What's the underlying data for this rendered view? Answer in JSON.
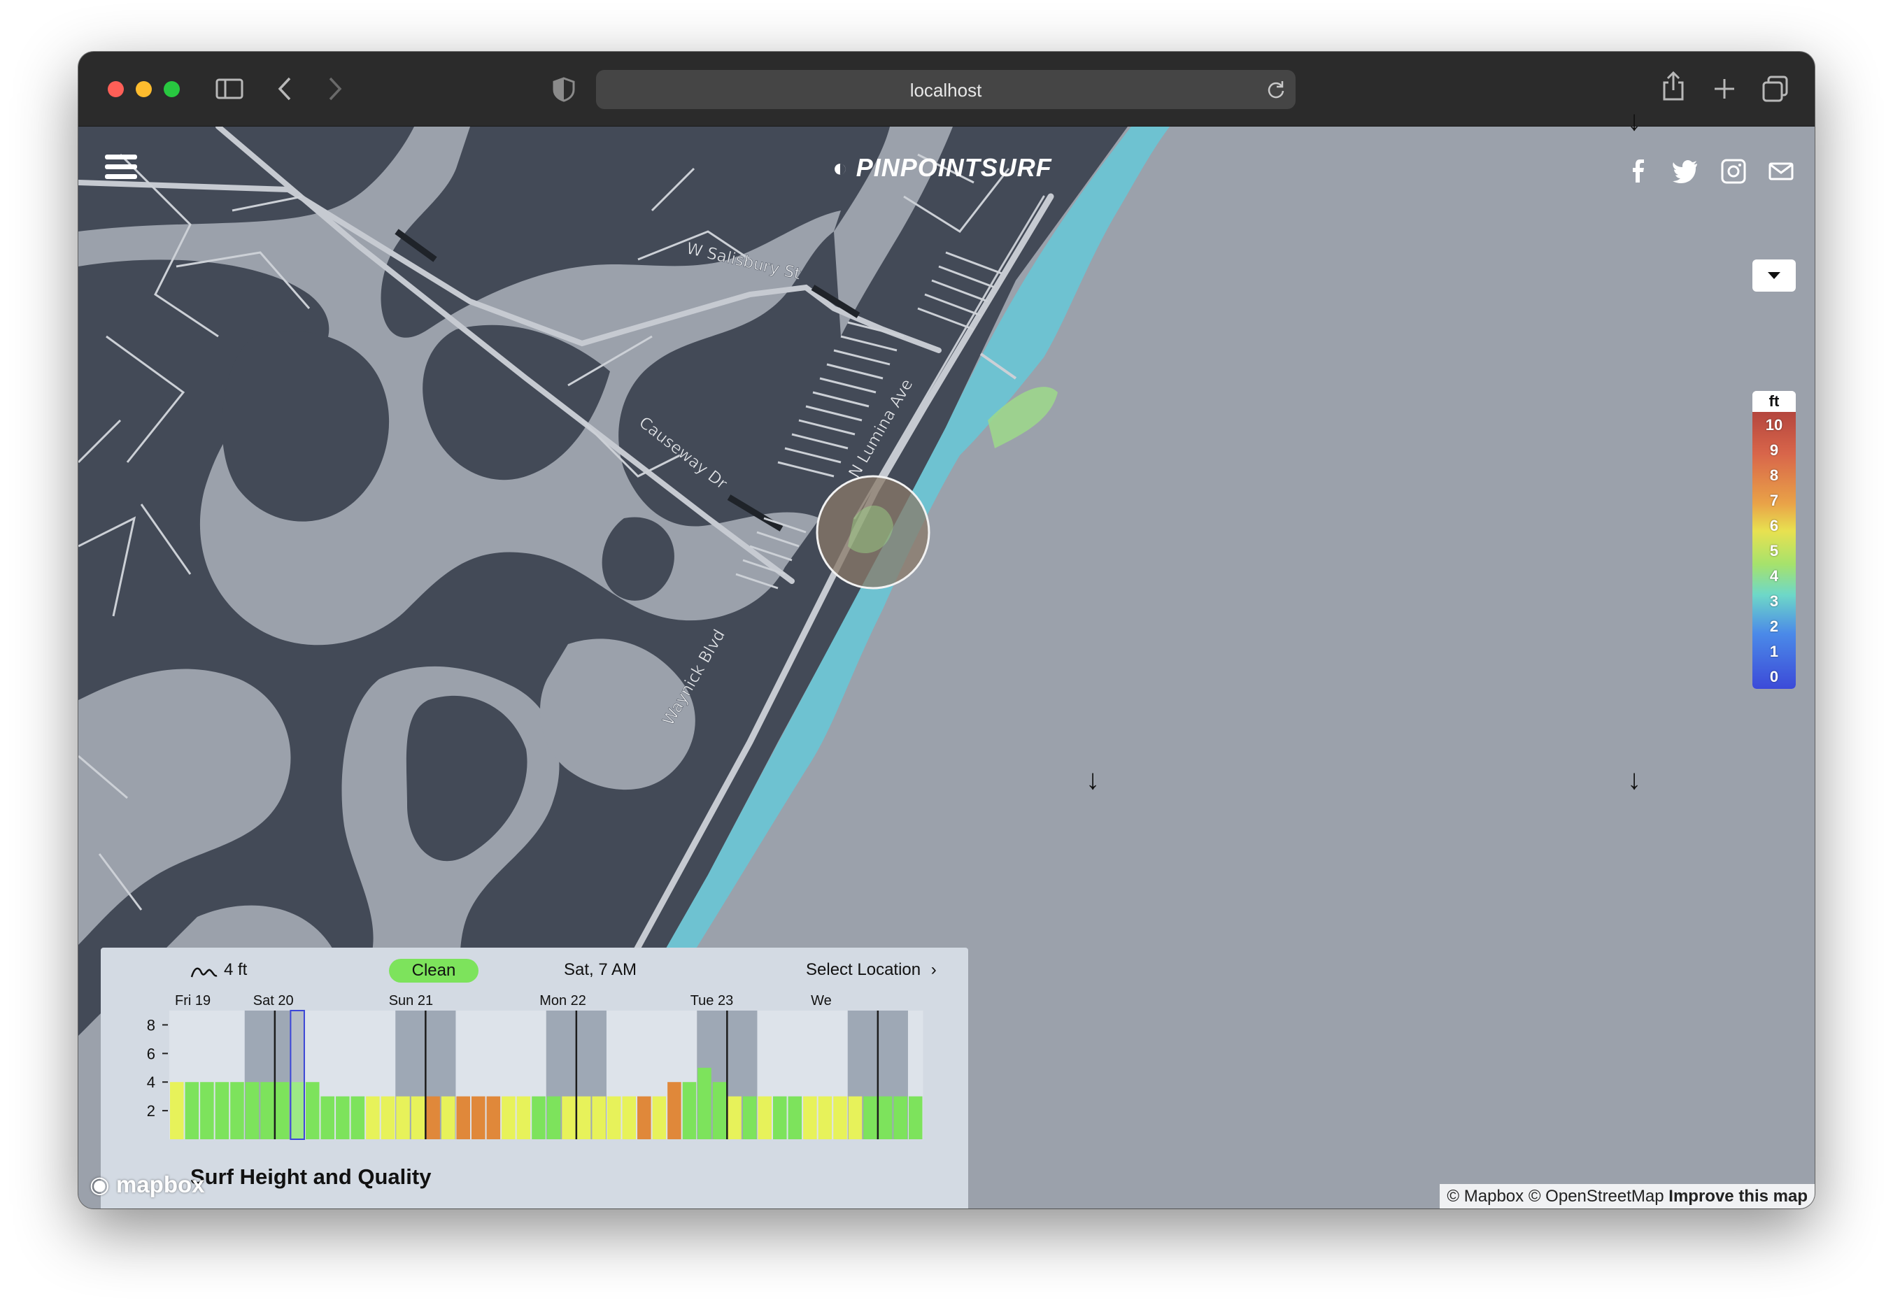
{
  "browser": {
    "url": "localhost"
  },
  "header": {
    "logo_text": "PINPOINTSURF",
    "social": [
      "facebook-icon",
      "twitter-icon",
      "instagram-icon",
      "mail-icon"
    ]
  },
  "map": {
    "street_labels": [
      "W Salisbury St",
      "Causeway Dr",
      "N Lumina Ave",
      "Waynick Blvd"
    ],
    "legend": {
      "unit": "ft",
      "levels": [
        "10",
        "9",
        "8",
        "7",
        "6",
        "5",
        "4",
        "3",
        "2",
        "1",
        "0"
      ]
    },
    "swell_arrow": "↓",
    "attribution": {
      "mapbox": "© Mapbox",
      "osm": "© OpenStreetMap",
      "improve": "Improve this map"
    },
    "mapbox_logo": "mapbox"
  },
  "panel": {
    "height": "4 ft",
    "quality": "Clean",
    "time": "Sat, 7 AM",
    "select_location": "Select Location",
    "title": "Surf Height and Quality"
  },
  "chart_data": {
    "type": "bar",
    "title": "Surf Height and Quality",
    "day_labels": [
      "Fri 19",
      "Sat 20",
      "Sun 21",
      "Mon 22",
      "Tue 23",
      "We"
    ],
    "y_ticks": [
      2,
      4,
      6,
      8
    ],
    "ylim": [
      0,
      9
    ],
    "selected_index": 8,
    "values": [
      4,
      4,
      4,
      4,
      4,
      4,
      4,
      4,
      4,
      4,
      3,
      3,
      3,
      3,
      3,
      3,
      3,
      3,
      3,
      3,
      3,
      3,
      3,
      3,
      3,
      3,
      3,
      3,
      3,
      3,
      3,
      3,
      3,
      4,
      4,
      5,
      4,
      3,
      3,
      3,
      3,
      3,
      3,
      3,
      3,
      3,
      3,
      3,
      3,
      3
    ],
    "quality": [
      "yellow",
      "green",
      "green",
      "green",
      "green",
      "green",
      "green",
      "green",
      "green",
      "green",
      "green",
      "green",
      "green",
      "yellow",
      "yellow",
      "yellow",
      "yellow",
      "orange",
      "yellow",
      "orange",
      "orange",
      "orange",
      "yellow",
      "yellow",
      "green",
      "green",
      "yellow",
      "yellow",
      "yellow",
      "yellow",
      "yellow",
      "orange",
      "yellow",
      "orange",
      "green",
      "green",
      "green",
      "yellow",
      "green",
      "yellow",
      "green",
      "green",
      "yellow",
      "yellow",
      "yellow",
      "yellow",
      "green",
      "green",
      "green",
      "green"
    ],
    "colors": {
      "green": "#7de35c",
      "yellow": "#e7f25a",
      "orange": "#e0883a"
    }
  }
}
